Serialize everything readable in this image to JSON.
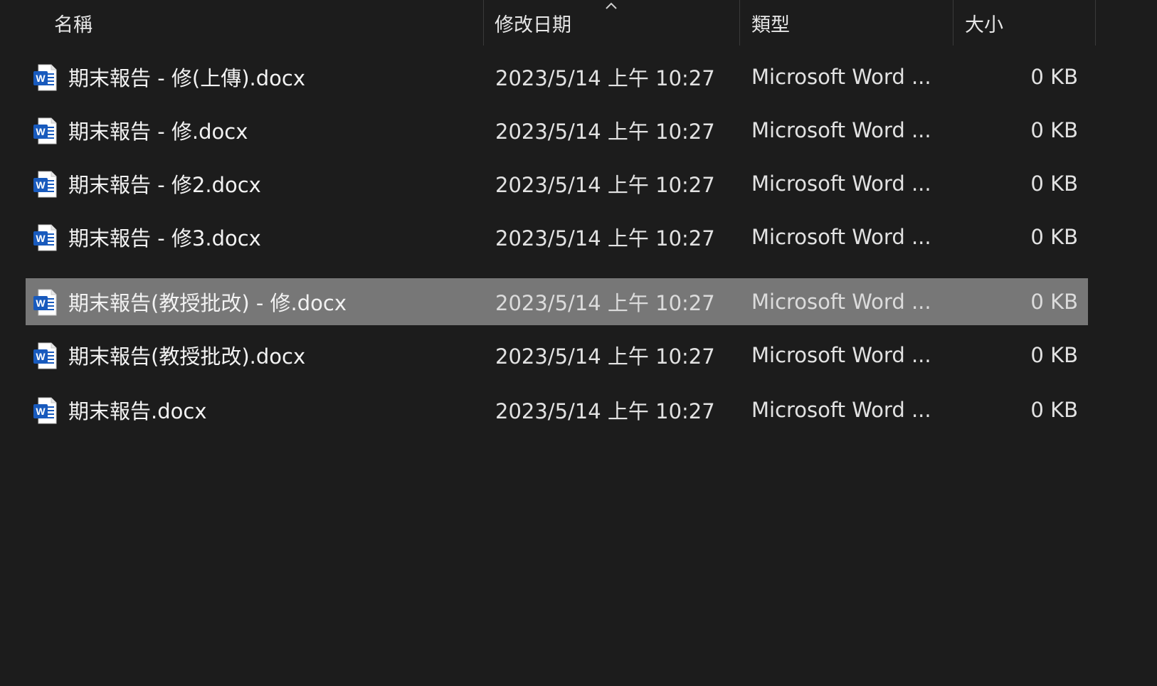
{
  "columns": {
    "name": "名稱",
    "modified": "修改日期",
    "type": "類型",
    "size": "大小"
  },
  "sort_indicator": "chevron-up-icon",
  "files": [
    {
      "name": "期末報告 - 修(上傳).docx",
      "modified": "2023/5/14 上午 10:27",
      "type": "Microsoft Word ...",
      "size": "0 KB",
      "icon": "word-document-icon",
      "selected": false
    },
    {
      "name": "期末報告 - 修.docx",
      "modified": "2023/5/14 上午 10:27",
      "type": "Microsoft Word ...",
      "size": "0 KB",
      "icon": "word-document-icon",
      "selected": false
    },
    {
      "name": "期末報告 - 修2.docx",
      "modified": "2023/5/14 上午 10:27",
      "type": "Microsoft Word ...",
      "size": "0 KB",
      "icon": "word-document-icon",
      "selected": false
    },
    {
      "name": "期末報告 - 修3.docx",
      "modified": "2023/5/14 上午 10:27",
      "type": "Microsoft Word ...",
      "size": "0 KB",
      "icon": "word-document-icon",
      "selected": false
    },
    {
      "name": "期末報告(教授批改) - 修.docx",
      "modified": "2023/5/14 上午 10:27",
      "type": "Microsoft Word ...",
      "size": "0 KB",
      "icon": "word-document-icon",
      "selected": true
    },
    {
      "name": "期末報告(教授批改).docx",
      "modified": "2023/5/14 上午 10:27",
      "type": "Microsoft Word ...",
      "size": "0 KB",
      "icon": "word-document-icon",
      "selected": false
    },
    {
      "name": "期末報告.docx",
      "modified": "2023/5/14 上午 10:27",
      "type": "Microsoft Word ...",
      "size": "0 KB",
      "icon": "word-document-icon",
      "selected": false
    }
  ],
  "colors": {
    "background": "#1c1c1c",
    "selected_row": "#777777",
    "word_blue": "#185abd"
  }
}
